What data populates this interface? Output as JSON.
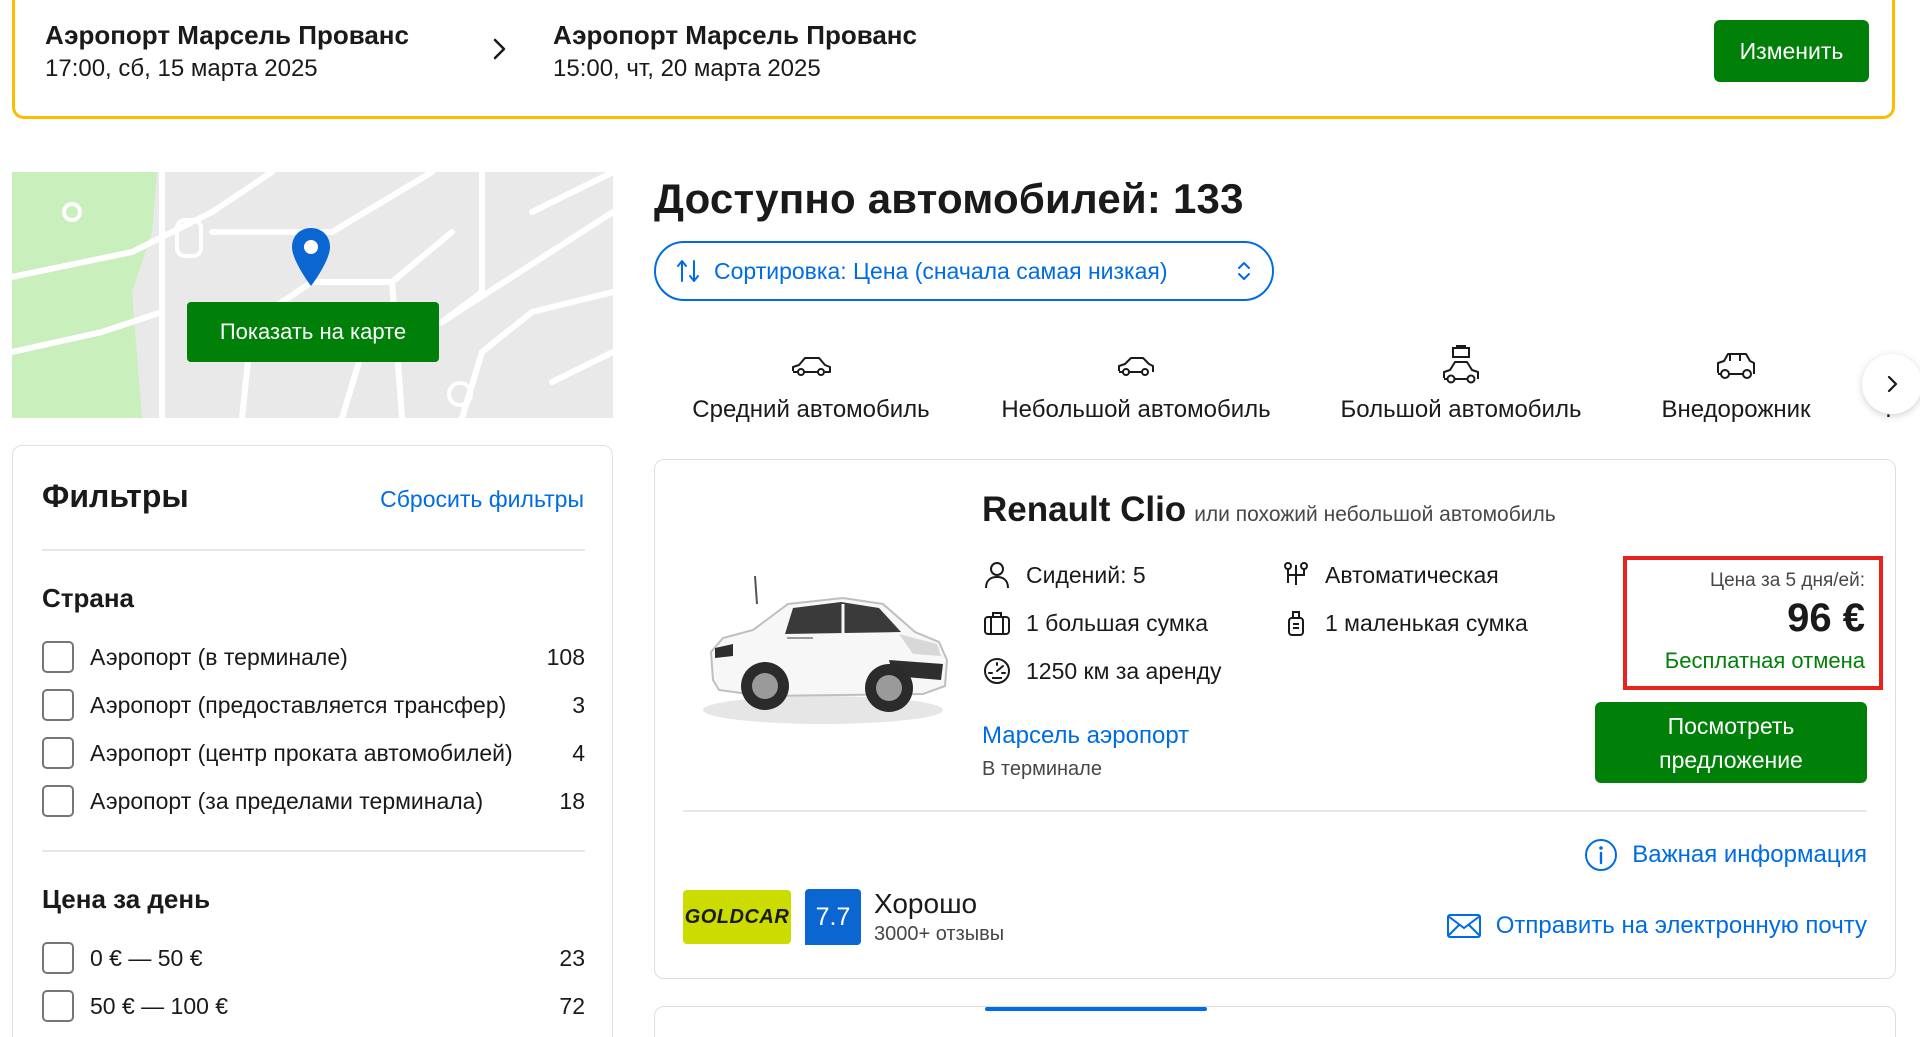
{
  "search": {
    "from_name": "Аэропорт Марсель Прованс",
    "from_time": "17:00, сб, 15 марта 2025",
    "to_name": "Аэропорт Марсель Прованс",
    "to_time": "15:00, чт, 20 марта 2025",
    "change_label": "Изменить"
  },
  "map": {
    "show_on_map_label": "Показать на карте"
  },
  "filters": {
    "title": "Фильтры",
    "reset_label": "Сбросить фильтры",
    "country": {
      "title": "Страна",
      "options": [
        {
          "label": "Аэропорт (в терминале)",
          "count": "108"
        },
        {
          "label": "Аэропорт (предоставляется трансфер)",
          "count": "3"
        },
        {
          "label": "Аэропорт (центр проката автомобилей)",
          "count": "4"
        },
        {
          "label": "Аэропорт (за пределами терминала)",
          "count": "18"
        }
      ]
    },
    "price_per_day": {
      "title": "Цена за день",
      "options": [
        {
          "label": "0 € — 50 €",
          "count": "23"
        },
        {
          "label": "50 € — 100 €",
          "count": "72"
        }
      ]
    }
  },
  "results": {
    "title": "Доступно автомобилей: 133",
    "sort_label": "Сортировка: Цена (сначала самая низкая)",
    "categories": [
      {
        "label": "Средний автомобиль",
        "icon": "sedan-icon"
      },
      {
        "label": "Небольшой автомобиль",
        "icon": "hatchback-icon"
      },
      {
        "label": "Большой автомобиль",
        "icon": "car-with-luggage-icon"
      },
      {
        "label": "Внедорожник",
        "icon": "suv-icon"
      }
    ]
  },
  "card": {
    "model": "Renault Clio",
    "similar": "или похожий небольшой автомобиль",
    "seats": "Сидений: 5",
    "transmission": "Автоматическая",
    "big_bags": "1 большая сумка",
    "small_bags": "1 маленькая сумка",
    "mileage": "1250 км за аренду",
    "pickup_location": "Марсель аэропорт",
    "pickup_type": "В терминале",
    "price_label": "Цена за 5 дня/ей:",
    "price_value": "96 €",
    "free_cancel": "Бесплатная отмена",
    "offer_line1": "Посмотреть",
    "offer_line2": "предложение",
    "important_info": "Важная информация",
    "send_email": "Отправить на электронную почту",
    "supplier": "GOLDCAR",
    "rating": "7.7",
    "rating_word": "Хорошо",
    "rating_count": "3000+ отзывы"
  },
  "colors": {
    "accent": "#006ce4",
    "primary_button": "#008009",
    "search_border": "#febb02",
    "highlight_box": "#e8231b",
    "rating_badge": "#0b66d2",
    "supplier_logo": "#cddc00"
  }
}
